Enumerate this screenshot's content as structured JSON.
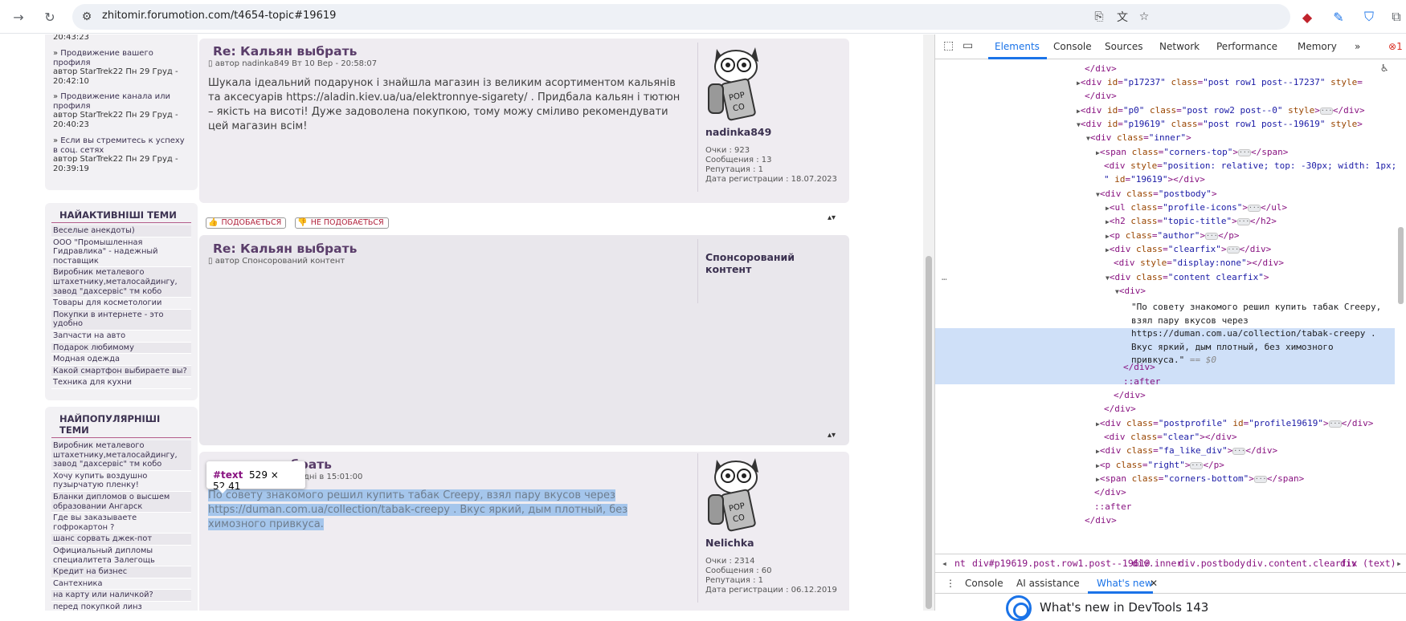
{
  "browser": {
    "url": "zhitomir.forumotion.com/t4654-topic#19619"
  },
  "sidebar": {
    "recent_top_cut": "20:43:23",
    "recent": [
      {
        "title": "Продвижение вашего профиля",
        "meta": "автор StarTrek22 Пн 29 Груд -",
        "time": "20:42:10"
      },
      {
        "title": "Продвижение канала или профиля",
        "meta": "автор StarTrek22 Пн 29 Груд -",
        "time": "20:40:23"
      },
      {
        "title": "Если вы стремитесь к успеху в соц. сетях",
        "meta": "автор StarTrek22 Пн 29 Груд -",
        "time": "20:39:19"
      }
    ],
    "active_title": "НАЙАКТИВНІШІ ТЕМИ",
    "active_topics": [
      "Веселые анекдоты)",
      "ООО \"Промышленная Гидравлика\" - надежный поставщик",
      "Виробник металевого штахетнику,металосайдингу, завод \"дахсервіс\" тм кобо",
      "Товары для косметологии",
      "Покупки в интернете - это удобно",
      "Запчасти на авто",
      "Подарок любимому",
      "Модная одежда",
      "Какой смартфон выбираете вы?",
      "Техника для кухни"
    ],
    "popular_title": "НАЙПОПУЛЯРНІШІ ТЕМИ",
    "popular_topics": [
      "Виробник металевого штахетнику,металосайдингу, завод \"дахсервіс\" тм кобо",
      "Хочу купить воздушно пузырчатую пленку!",
      "Бланки дипломов о высшем образовании Ангарск",
      "Где вы заказываете гофрокартон ?",
      "шанс сорвать джек-пот",
      "Официальный дипломы специалитета Залегощь",
      "Кредит на бизнес",
      "Сантехника",
      "на карту или наличкой?",
      "перед покупкой линз"
    ]
  },
  "posts": [
    {
      "title": "Re: Кальян выбрать",
      "author_line": "автор nadinka849 Вт 10 Вер - 20:58:07",
      "body": "Шукала ідеальний подарунок і знайшла магазин із великим асортиментом кальянів та аксесуарів https://aladin.kiev.ua/ua/elektronnye-sigarety/ . Придбала кальян і тютюн – якість на висоті! Дуже задоволена покупкою, тому можу сміливо рекомендувати цей магазин всім!",
      "profile_name": "nadinka849",
      "stats": [
        "Очки : 923",
        "Сообщения : 13",
        "Репутация : 1",
        "Дата регистрации : 18.07.2023"
      ]
    },
    {
      "title": "Re: Кальян выбрать",
      "author_line": "автор Спонсорований контент",
      "profile_name": "Спонсорований контент"
    },
    {
      "title": "Re: Кальян выбрать",
      "author_line": "дні в 15:01:00",
      "body": "По совету знакомого решил купить табак Creepy, взял пару вкусов через https://duman.com.ua/collection/tabak-creepy . Вкус яркий, дым плотный, без химозного привкуса.",
      "profile_name": "Nelichka",
      "stats": [
        "Очки : 2314",
        "Сообщения : 60",
        "Репутация : 1",
        "Дата регистрации : 06.12.2019"
      ]
    }
  ],
  "likes": {
    "like": "ПОДОБАЄТЬСЯ",
    "dislike": "НЕ ПОДОБАЄТЬСЯ"
  },
  "tooltip": {
    "node": "#text",
    "size": "529 × 52.41"
  },
  "devtools": {
    "tabs": [
      "Elements",
      "Console",
      "Sources",
      "Network",
      "Performance",
      "Memory"
    ],
    "error_count": "1",
    "selected_text": "\"По совету знакомого решил купить табак Creepy, взял пару вкусов через https://duman.com.ua/collection/tabak-creepy . Вкус яркий, дым плотный, без химозного привкуса.\"",
    "dollar_zero": "== $0",
    "breadcrumbs": [
      "nt",
      "div#p19619.post.row1.post--19619",
      "div.inner",
      "div.postbody",
      "div.content.clearfix",
      "div",
      "(text)"
    ],
    "drawer_tabs": [
      "Console",
      "AI assistance",
      "What's new"
    ],
    "whatsnew_title": "What's new in DevTools 143"
  }
}
